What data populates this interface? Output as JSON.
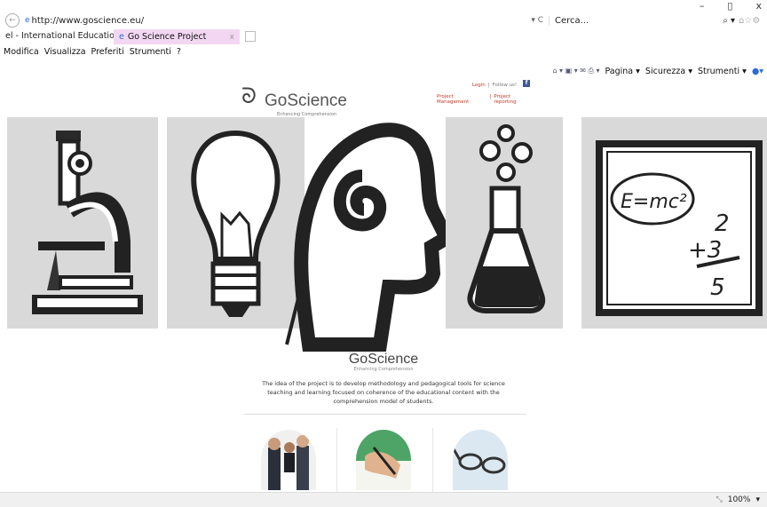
{
  "browser": {
    "address": "http://www.goscience.eu/",
    "address_actions": "▾ C",
    "search_placeholder": "Cerca...",
    "search_icon": "search-icon",
    "window_controls": [
      "–",
      "▯",
      "x"
    ],
    "tabs": [
      {
        "label": "el - International Education a..."
      },
      {
        "label": "Go Science Project",
        "close": "x"
      }
    ],
    "menu": [
      "Modifica",
      "Visualizza",
      "Preferiti",
      "Strumenti",
      "?"
    ],
    "command_bar": [
      "Pagina ▾",
      "Sicurezza ▾",
      "Strumenti ▾"
    ],
    "command_icons": "⌂ ▾ ▣ ▾ ✉ ⎙ ▾",
    "zoom": "100%"
  },
  "site": {
    "logo_name": "GoScience",
    "logo_tagline": "Enhancing Comprehension",
    "login": "Login",
    "follow": "Follow us!",
    "links": [
      "Project Management",
      "Project reporting"
    ],
    "fb": "f",
    "brand": "GoScience",
    "brand_tagline": "Enhancing Comprehension",
    "description": "The idea of the project is to develop methodology and pedagogical tools for science teaching and learning focused on coherence of the educational content with the comprehension model of students.",
    "formula": "E=mc²",
    "sum": [
      "2",
      "+3",
      "5"
    ]
  }
}
